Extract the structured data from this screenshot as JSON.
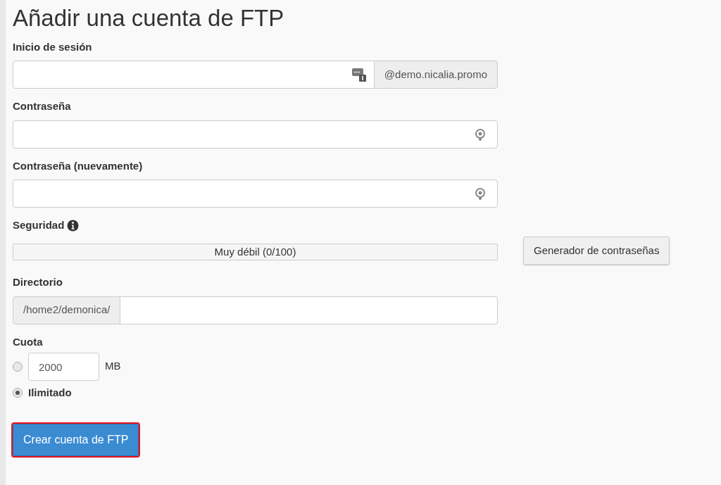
{
  "title": "Añadir una cuenta de FTP",
  "login": {
    "label": "Inicio de sesión",
    "domain": "@demo.nicalia.promo"
  },
  "password": {
    "label": "Contraseña"
  },
  "password_again": {
    "label": "Contraseña (nuevamente)"
  },
  "security": {
    "label": "Seguridad",
    "level": 0,
    "reading": "Muy débil (0/100)",
    "generator_button": "Generador de contraseñas"
  },
  "directory": {
    "label": "Directorio",
    "prefix": "/home2/demonica/"
  },
  "quota": {
    "label": "Cuota",
    "options": [
      {
        "kind": "amount",
        "value": "2000",
        "unit": "MB",
        "selected": false
      },
      {
        "kind": "text",
        "label": "Ilimitado",
        "selected": true
      }
    ]
  },
  "submit": {
    "label": "Crear cuenta de FTP",
    "highlighted": true
  }
}
